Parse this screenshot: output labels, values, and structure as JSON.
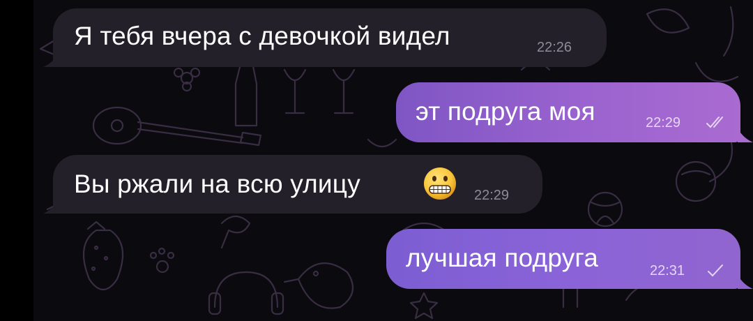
{
  "messages": [
    {
      "direction": "incoming",
      "text": "Я тебя вчера с девочкой видел",
      "time": "22:26"
    },
    {
      "direction": "outgoing",
      "text": "эт подруга моя",
      "time": "22:29",
      "status_icon": "double-check-icon"
    },
    {
      "direction": "incoming",
      "text": "Вы ржали на всю улицу",
      "emoji": "grimacing-face-emoji-icon",
      "time": "22:29"
    },
    {
      "direction": "outgoing",
      "text": "лучшая подруга",
      "time": "22:31",
      "status_icon": "single-check-icon"
    }
  ],
  "colors": {
    "incoming_bubble": "#232029",
    "outgoing_bubble": "#9b63cf",
    "background": "#0b0a0e",
    "doodle_stroke": "#5e4a6e"
  },
  "wallpaper": "doodle-pattern"
}
